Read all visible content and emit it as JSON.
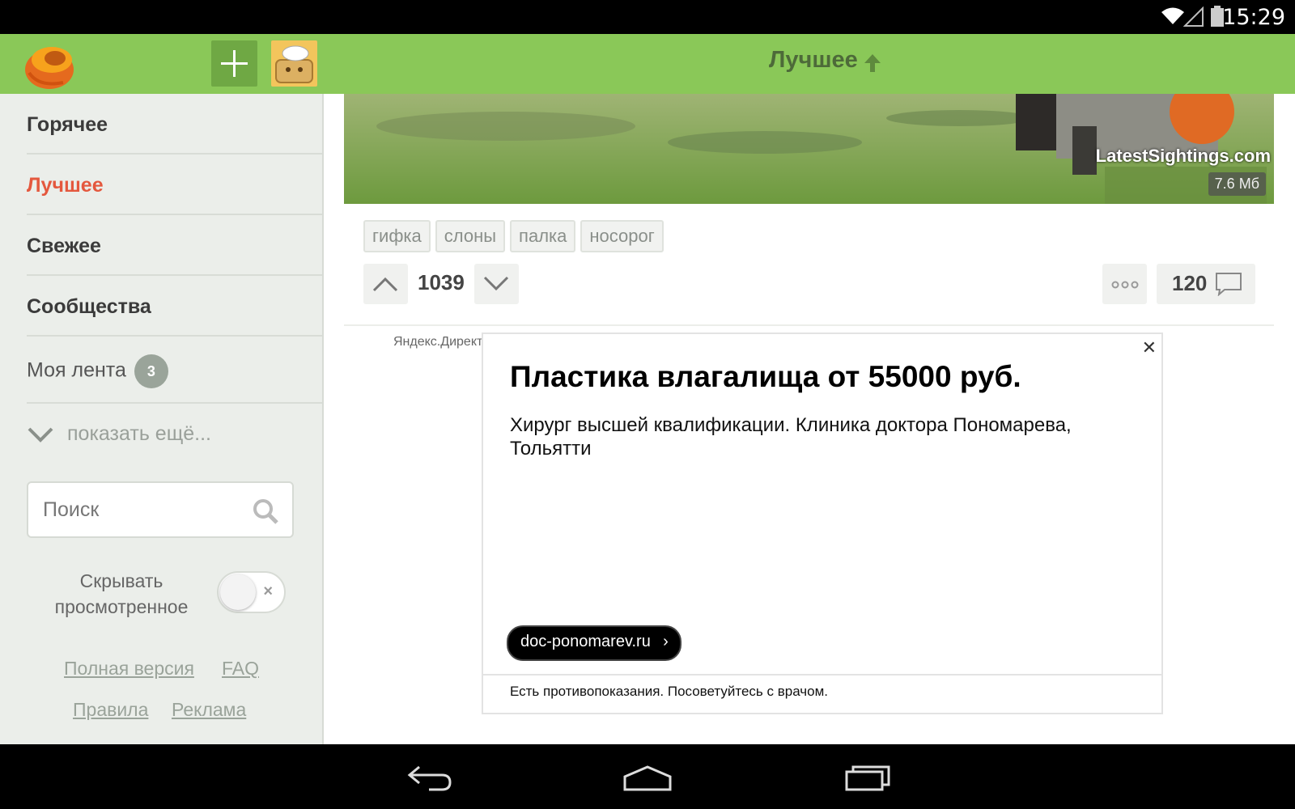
{
  "status_bar": {
    "time": "15:29"
  },
  "header": {
    "title": "Лучшее",
    "logo_icon": "pikabu-logo-icon",
    "add_icon": "plus-icon",
    "avatar_icon": "user-avatar"
  },
  "sidebar": {
    "items": [
      {
        "label": "Горячее"
      },
      {
        "label": "Лучшее"
      },
      {
        "label": "Свежее"
      },
      {
        "label": "Сообщества"
      },
      {
        "label": "Моя лента",
        "badge": "3"
      }
    ],
    "show_more": "показать ещё...",
    "search_placeholder": "Поиск",
    "hide_viewed": "Скрывать просмотренное",
    "footer_links": [
      "Полная версия",
      "FAQ",
      "Правила",
      "Реклама"
    ]
  },
  "post": {
    "gif_size": "7.6 Мб",
    "watermark": "LatestSightings.com",
    "tags": [
      "гифка",
      "слоны",
      "палка",
      "носорог"
    ],
    "score": "1039",
    "comments": "120"
  },
  "ad": {
    "source": "Яндекс.Директ",
    "title": "Пластика влагалища от 55000 руб.",
    "text": "Хирург высшей квалификации. Клиника доктора Пономарева, Тольятти",
    "link": "doc-ponomarev.ru",
    "warning": "Есть противопоказания. Посоветуйтесь с врачом."
  },
  "colors": {
    "topbar": "#8ac858",
    "active": "#e4583e",
    "sidebar_bg": "#ebeeea"
  }
}
